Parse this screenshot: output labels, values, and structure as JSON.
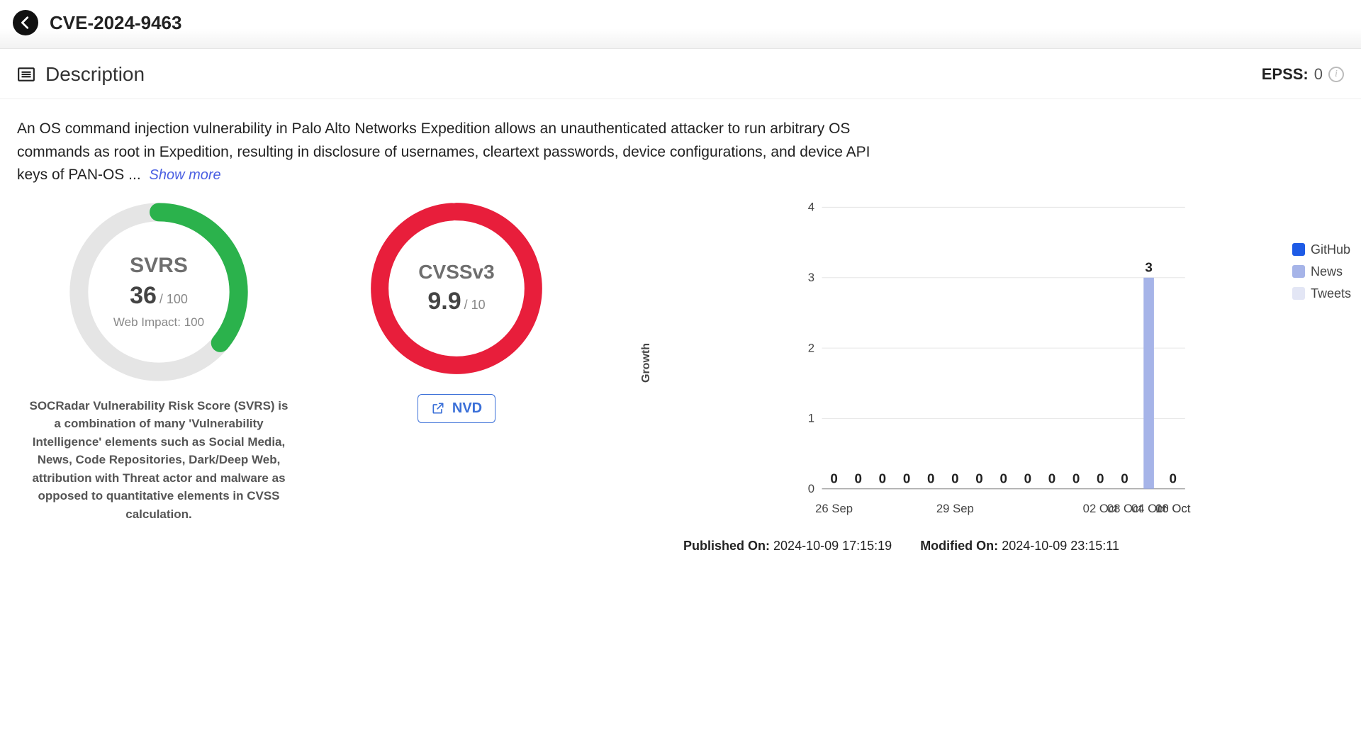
{
  "header": {
    "title": "CVE-2024-9463"
  },
  "section": {
    "heading": "Description"
  },
  "epss": {
    "label": "EPSS:",
    "value": "0"
  },
  "description": {
    "text": "An OS command injection vulnerability in Palo Alto Networks Expedition allows an unauthenticated attacker to run arbitrary OS commands as root in Expedition, resulting in disclosure of usernames, cleartext passwords, device configurations, and device API keys of PAN-OS ...",
    "show_more": "Show more"
  },
  "svrs": {
    "title": "SVRS",
    "value": "36",
    "max": "/ 100",
    "sub": "Web Impact: 100",
    "pct": 36,
    "color": "#2bb24c",
    "desc": "SOCRadar Vulnerability Risk Score (SVRS) is a combination of many 'Vulnerability Intelligence' elements such as Social Media, News, Code Repositories, Dark/Deep Web, attribution with Threat actor and malware as opposed to quantitative elements in CVSS calculation."
  },
  "cvss": {
    "title": "CVSSv3",
    "value": "9.9",
    "max": "/ 10",
    "pct": 99,
    "color": "#e81e3b",
    "link_label": "NVD"
  },
  "chart_data": {
    "type": "bar",
    "title": "",
    "ylabel": "Growth",
    "xlabel": "",
    "ylim": [
      0,
      4
    ],
    "yticks": [
      0,
      1,
      2,
      3,
      4
    ],
    "categories": [
      "26 Sep",
      "",
      "29 Sep",
      "",
      "",
      "02 Oct",
      "04 Oct",
      "06 Oct",
      "08 Oct",
      "10 Oct"
    ],
    "x_tick_positions": [
      0,
      2,
      5,
      7,
      9,
      11,
      13,
      14
    ],
    "series": [
      {
        "name": "GitHub",
        "color": "#1e5be6",
        "values": [
          0,
          0,
          0,
          0,
          0,
          0,
          0,
          0,
          0,
          0,
          0,
          0,
          0,
          0,
          0
        ]
      },
      {
        "name": "News",
        "color": "#a6b4e8",
        "values": [
          0,
          0,
          0,
          0,
          0,
          0,
          0,
          0,
          0,
          0,
          0,
          0,
          0,
          3,
          0
        ]
      },
      {
        "name": "Tweets",
        "color": "#e3e6f5",
        "values": [
          0,
          0,
          0,
          0,
          0,
          0,
          0,
          0,
          0,
          0,
          0,
          0,
          0,
          0,
          0
        ]
      }
    ],
    "totals": [
      0,
      0,
      0,
      0,
      0,
      0,
      0,
      0,
      0,
      0,
      0,
      0,
      0,
      3,
      0
    ],
    "legend": [
      {
        "name": "GitHub",
        "color": "#1e5be6"
      },
      {
        "name": "News",
        "color": "#a6b4e8"
      },
      {
        "name": "Tweets",
        "color": "#e3e6f5"
      }
    ]
  },
  "meta": {
    "published_label": "Published On:",
    "published_value": "2024-10-09 17:15:19",
    "modified_label": "Modified On:",
    "modified_value": "2024-10-09 23:15:11"
  }
}
